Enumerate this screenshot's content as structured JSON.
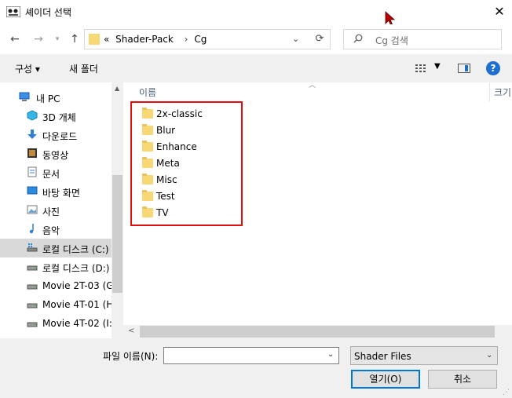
{
  "window": {
    "title": "셰이더 선택"
  },
  "nav": {
    "breadcrumb": [
      "«",
      "Shader-Pack",
      "Cg"
    ],
    "search_placeholder": "Cg 검색"
  },
  "toolbar": {
    "organize": "구성 ▾",
    "new_folder": "새 폴더"
  },
  "sidebar": {
    "items": [
      {
        "label": "내 PC",
        "icon": "pc-icon"
      },
      {
        "label": "3D 개체",
        "icon": "3d-objects-icon"
      },
      {
        "label": "다운로드",
        "icon": "download-icon"
      },
      {
        "label": "동영상",
        "icon": "video-icon"
      },
      {
        "label": "문서",
        "icon": "document-icon"
      },
      {
        "label": "바탕 화면",
        "icon": "desktop-icon"
      },
      {
        "label": "사진",
        "icon": "picture-icon"
      },
      {
        "label": "음악",
        "icon": "music-icon"
      },
      {
        "label": "로컬 디스크 (C:)",
        "icon": "drive-icon"
      },
      {
        "label": "로컬 디스크 (D:)",
        "icon": "drive-icon"
      },
      {
        "label": "Movie 2T-03 (G",
        "icon": "drive-icon"
      },
      {
        "label": "Movie 4T-01 (H",
        "icon": "drive-icon"
      },
      {
        "label": "Movie 4T-02 (I:)",
        "icon": "drive-icon"
      }
    ]
  },
  "filelist": {
    "column_name": "이름",
    "column_size": "크기",
    "items": [
      "2x-classic",
      "Blur",
      "Enhance",
      "Meta",
      "Misc",
      "Test",
      "TV"
    ]
  },
  "footer": {
    "filename_label": "파일 이름(N):",
    "filename_value": "",
    "filetype": "Shader Files",
    "open_button": "열기(O)",
    "cancel_button": "취소"
  }
}
